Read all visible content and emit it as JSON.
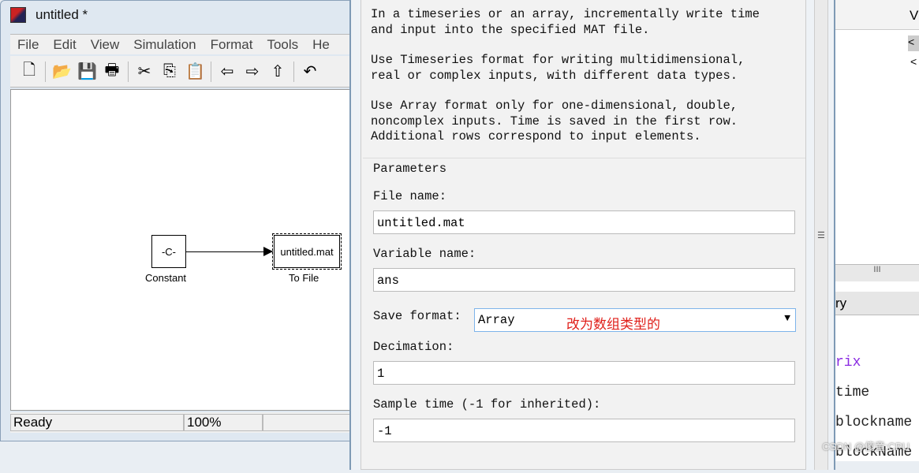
{
  "window": {
    "title": "untitled *"
  },
  "menu": [
    "File",
    "Edit",
    "View",
    "Simulation",
    "Format",
    "Tools",
    "He"
  ],
  "toolbar": [
    {
      "icon": "new-icon",
      "g": "🗋"
    },
    {
      "icon": "open-icon",
      "g": "📂"
    },
    {
      "icon": "save-icon",
      "g": "💾"
    },
    {
      "icon": "print-icon",
      "g": "🖶"
    },
    {
      "icon": "cut-icon",
      "g": "✂"
    },
    {
      "icon": "copy-icon",
      "g": "⎘"
    },
    {
      "icon": "paste-icon",
      "g": "📋"
    },
    {
      "icon": "back-icon",
      "g": "⇦"
    },
    {
      "icon": "forward-icon",
      "g": "⇨"
    },
    {
      "icon": "up-icon",
      "g": "⇧"
    },
    {
      "icon": "undo-icon",
      "g": "↶"
    }
  ],
  "model": {
    "constant_text": "-C-",
    "constant_label": "Constant",
    "tofile_text": "untitled.mat",
    "tofile_label": "To File"
  },
  "status": {
    "text": "Ready",
    "zoom": "100%"
  },
  "dialog": {
    "description": [
      "In a timeseries or an array, incrementally write time\nand input into the specified MAT file.",
      "Use Timeseries format for writing multidimensional,\nreal or complex inputs, with different data types.",
      "Use Array format only for one-dimensional, double,\nnoncomplex inputs. Time is saved in the first row.\nAdditional rows correspond to input elements."
    ],
    "parameters_title": "Parameters",
    "file_name_label": "File name:",
    "file_name": "untitled.mat",
    "variable_name_label": "Variable name:",
    "variable_name": "ans",
    "save_format_label": "Save format:",
    "save_format": "Array",
    "annotation": "改为数组类型的",
    "decimation_label": "Decimation:",
    "decimation": "1",
    "sample_time_label": "Sample time (-1 for inherited):",
    "sample_time": "-1"
  },
  "right_panel": {
    "header": "V",
    "items": [
      "<",
      "<"
    ],
    "scroll_grip": "III",
    "section": "ry",
    "code": [
      "rix",
      "time",
      "blockname",
      "blockName"
    ]
  },
  "watermark": "CSDN @傻童:CPU"
}
